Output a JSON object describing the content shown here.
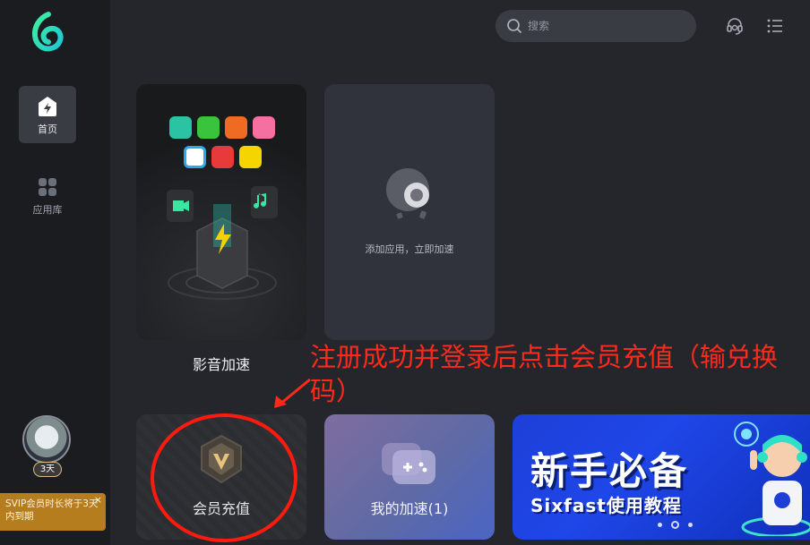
{
  "sidebar": {
    "nav": [
      {
        "label": "首页",
        "icon": "home-icon",
        "active": true
      },
      {
        "label": "应用库",
        "icon": "apps-grid-icon",
        "active": false
      }
    ],
    "member_days": "3天",
    "vip_tip": "SVIP会员时长将于3天内到期",
    "vip_tip_close": "×"
  },
  "topbar": {
    "search_placeholder": "搜索",
    "icons": [
      "customer-service-icon",
      "menu-list-icon"
    ]
  },
  "cards": {
    "media": {
      "label": "影音加速"
    },
    "add": {
      "label": "添加应用，立即加速"
    },
    "member": {
      "label": "会员充值"
    },
    "mine": {
      "label": "我的加速(1)"
    },
    "banner": {
      "title": "新手必备",
      "subtitle": "Sixfast使用教程",
      "dots": 3,
      "active_dot": 1
    }
  },
  "annotation": {
    "text": "注册成功并登录后点击会员充值（输兑换码）",
    "color": "#ff2a1a"
  },
  "colors": {
    "accent_green": "#36e08f",
    "sidebar_bg": "#1b1c20",
    "main_bg": "#24262c",
    "banner_blue": "#1f46e8",
    "vip_gold": "#b57d1d"
  }
}
